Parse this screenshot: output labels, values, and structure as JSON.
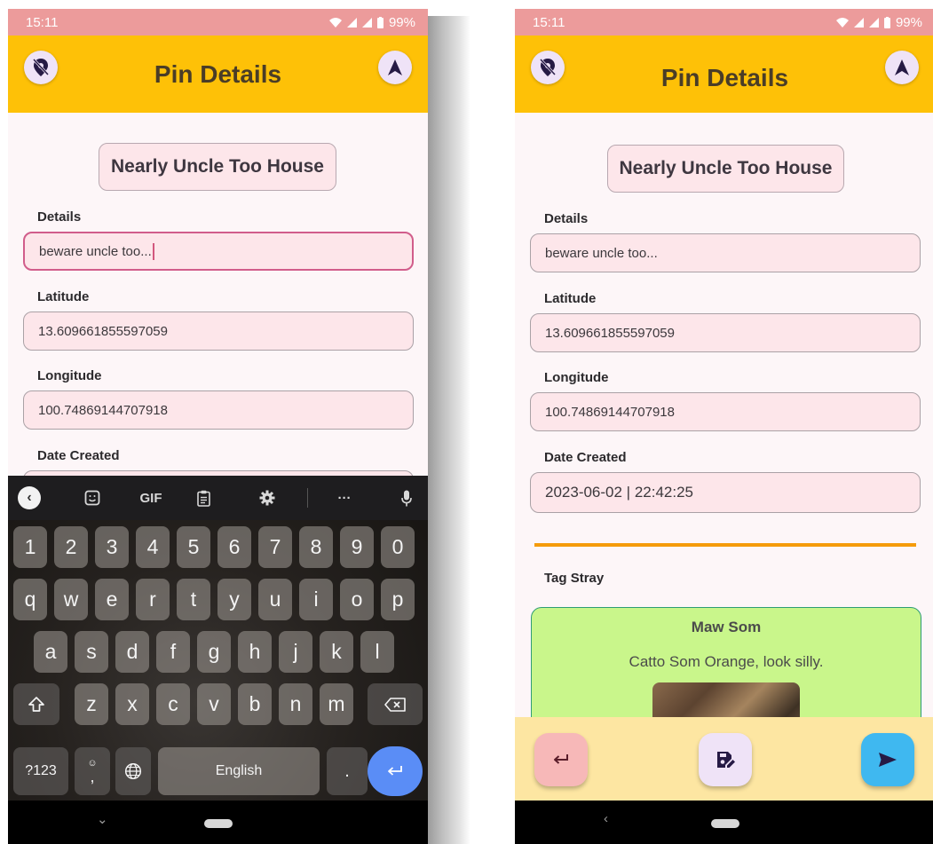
{
  "status": {
    "time": "15:11",
    "battery": "99%"
  },
  "app": {
    "title": "Pin Details"
  },
  "pin": {
    "name": "Nearly Uncle Too House",
    "details_label": "Details",
    "details_value": "beware uncle too...",
    "latitude_label": "Latitude",
    "latitude_value": "13.609661855597059",
    "longitude_label": "Longitude",
    "longitude_value": "100.74869144707918",
    "date_label": "Date Created",
    "date_value": "2023-06-02 | 22:42:25"
  },
  "tag": {
    "label": "Tag Stray",
    "stray_name": "Maw Som",
    "stray_description": "Catto Som Orange, look silly."
  },
  "keyboard": {
    "toolbar": {
      "gif": "GIF",
      "more": "···"
    },
    "row_numbers": [
      "1",
      "2",
      "3",
      "4",
      "5",
      "6",
      "7",
      "8",
      "9",
      "0"
    ],
    "row_top": [
      "q",
      "w",
      "e",
      "r",
      "t",
      "y",
      "u",
      "i",
      "o",
      "p"
    ],
    "row_middle": [
      "a",
      "s",
      "d",
      "f",
      "g",
      "h",
      "j",
      "k",
      "l"
    ],
    "row_bottom": [
      "z",
      "x",
      "c",
      "v",
      "b",
      "n",
      "m"
    ],
    "symbols_key": "?123",
    "comma_key": ",",
    "space_label": "English",
    "period_key": "."
  },
  "colors": {
    "status_bar": "#ec9b9b",
    "app_bar": "#fec107",
    "field_background": "#fde6ea",
    "card_background": "#c9f68b",
    "divider": "#f59b0b",
    "bottom_bar": "#fde6a2",
    "back_button": "#f7b8b8",
    "save_button": "#efe3f7",
    "send_button": "#3fb8f0",
    "enter_key": "#5a8df6"
  },
  "icons": {
    "left_appbar": "location-off-icon",
    "right_appbar": "navigation-arrow-icon",
    "back_fab": "return-arrow-icon",
    "save_fab": "save-edit-icon",
    "send_fab": "send-icon"
  }
}
